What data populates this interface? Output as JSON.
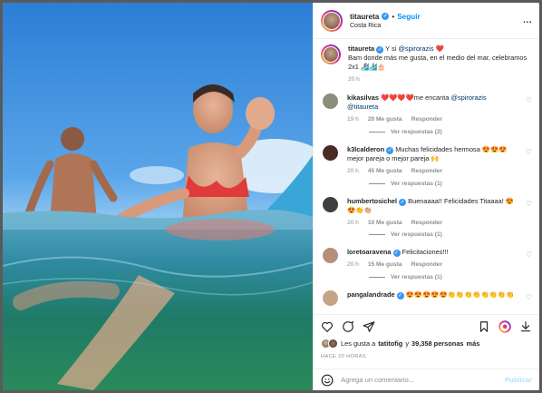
{
  "post": {
    "username": "titaureta",
    "follow_label": "Seguir",
    "location": "Costa Rica",
    "more_label": "..."
  },
  "caption": {
    "username": "titaureta",
    "mention": "@spirorazis",
    "text_before": " Y si ",
    "heart": "❤️",
    "text_after": "Bam donde más me gusta, en el medio del mar, celebramos 2x1 🏄‍♀️🏄‍♂️🎂",
    "time": "20 h"
  },
  "comments": [
    {
      "username": "kikasilvas",
      "verified": false,
      "text": "❤️❤️❤️❤️me encanta ",
      "mention": "@spirorazis @titaureta",
      "time": "19 h",
      "likes": "20 Me gusta",
      "reply": "Responder",
      "replies": "Ver respuestas (2)",
      "avatar_color": "#8a8f7a"
    },
    {
      "username": "k3lcalderon",
      "verified": true,
      "text": "Muchas felicidades hermosa 😍😍😍mejor pareja o mejor pareja 🙌",
      "mention": "",
      "time": "20 h",
      "likes": "45 Me gusta",
      "reply": "Responder",
      "replies": "Ver respuestas (1)",
      "avatar_color": "#4a2b24"
    },
    {
      "username": "humbertosichel",
      "verified": true,
      "text": "Buenaaaa!! Felicidades Titaaaa! 😍😍👏👏🏼",
      "mention": "",
      "time": "20 h",
      "likes": "10 Me gusta",
      "reply": "Responder",
      "replies": "Ver respuestas (1)",
      "avatar_color": "#3f3f3f"
    },
    {
      "username": "loretoaravena",
      "verified": true,
      "text": "Felicitaciones!!!",
      "mention": "",
      "time": "20 h",
      "likes": "15 Me gusta",
      "reply": "Responder",
      "replies": "Ver respuestas (1)",
      "avatar_color": "#b58f78"
    },
    {
      "username": "pangalandrade",
      "verified": true,
      "text": "😍😍😍😍😍👏👏👏👏👏👏👏👏",
      "mention": "",
      "time": "",
      "likes": "",
      "reply": "",
      "replies": "",
      "avatar_color": "#c7a386"
    }
  ],
  "likes_summary": {
    "prefix": "Les gusta a ",
    "user": "tatitofig",
    "middle": " y ",
    "count": "39,358 personas",
    "suffix": " más"
  },
  "time_ago": "HACE 20 HORAS",
  "add_comment": {
    "placeholder": "Agrega un comentario...",
    "publish": "Publicar"
  },
  "icons": [
    "verified-icon",
    "more-icon",
    "heart-icon",
    "comment-icon",
    "share-icon",
    "bookmark-icon",
    "reels-icon",
    "download-icon",
    "emoji-icon"
  ],
  "colors": {
    "accent": "#0095f6",
    "verified": "#3897f0",
    "heart": "#ed4956",
    "muted": "#8e8e8e"
  }
}
